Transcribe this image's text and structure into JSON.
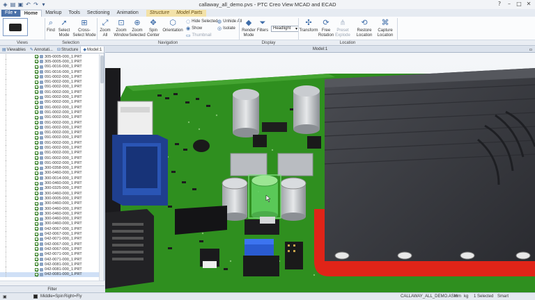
{
  "window": {
    "title": "callaway_all_demo.pvs - PTC Creo View MCAD and ECAD",
    "quick_access_icons": [
      "app-icon",
      "open-icon",
      "save-icon",
      "undo-icon",
      "redo-icon",
      "dropdown-icon"
    ]
  },
  "tabs": [
    {
      "label": "File",
      "kind": "file"
    },
    {
      "label": "Home",
      "kind": "active"
    },
    {
      "label": "Markup",
      "kind": "normal"
    },
    {
      "label": "Tools",
      "kind": "normal"
    },
    {
      "label": "Sectioning",
      "kind": "normal"
    },
    {
      "label": "Animation",
      "kind": "normal"
    },
    {
      "label": "Structure",
      "kind": "ctx"
    },
    {
      "label": "Model Parts",
      "kind": "ctx"
    }
  ],
  "ribbon": {
    "find": "Find",
    "select_mode": "Select Mode",
    "cross_select_mode": "Cross-Select Mode",
    "zoom_all": "Zoom All",
    "zoom_window": "Zoom Window",
    "zoom_selected": "Zoom Selected",
    "spin_center": "Spin Center",
    "orientation": "Orientation",
    "hide_selected": "Hide Selected",
    "show": "Show",
    "thumbnail": "Thumbnail",
    "unhide_all": "Unhide All",
    "isolate": "Isolate",
    "render_mode": "Render Mode",
    "filters": "Filters",
    "lighting": "Headlight",
    "transform": "Transform",
    "free_rotation": "Free Rotation",
    "preset_explode": "Preset Explode",
    "restore_location": "Restore Location",
    "capture_location": "Capture Location",
    "groups": [
      "Views",
      "Selection",
      "Navigation",
      "Display",
      "Location"
    ]
  },
  "panel": {
    "tabs": [
      "Viewables",
      "Annotati...",
      "Structure",
      "Model:1"
    ],
    "filter_label": "Filter",
    "tree_items": [
      "305-0005-000_1.PRT",
      "305-0005-000_1.PRT",
      "091-0016-000_1.PRT",
      "091-0016-000_1.PRT",
      "091-0002-000_1.PRT",
      "091-0002-000_1.PRT",
      "091-0002-000_1.PRT",
      "091-0002-000_1.PRT",
      "091-0002-000_1.PRT",
      "091-0002-000_1.PRT",
      "091-0002-000_1.PRT",
      "091-0002-000_1.PRT",
      "091-0002-000_1.PRT",
      "091-0002-000_1.PRT",
      "091-0002-000_1.PRT",
      "091-0002-000_1.PRT",
      "091-0002-000_1.PRT",
      "091-0002-000_1.PRT",
      "091-0002-000_1.PRT",
      "091-0002-000_1.PRT",
      "091-0002-000_1.PRT",
      "091-0002-000_1.PRT",
      "300-0358-000_1.PRT",
      "300-0460-000_1.PRT",
      "300-0014-000_1.PRT",
      "300-0460-000_1.PRT",
      "300-0325-000_1.PRT",
      "300-0460-000_1.PRT",
      "300-0005-000_1.PRT",
      "300-0460-000_1.PRT",
      "300-0460-000_1.PRT",
      "300-0460-000_1.PRT",
      "300-0460-000_1.PRT",
      "300-0460-000_1.PRT",
      "042-0067-000_1.PRT",
      "042-0067-000_1.PRT",
      "042-0071-000_1.PRT",
      "042-0067-000_1.PRT",
      "042-0067-000_1.PRT",
      "042-0071-000_1.PRT",
      "042-0071-000_1.PRT",
      "042-0081-000_1.PRT",
      "042-0081-000_1.PRT",
      "042-0081-000_1.PRT"
    ],
    "selected_item": "042-0081-000_1.PRT"
  },
  "viewport": {
    "title": "Model:1"
  },
  "status": {
    "middle": "Middle=Spin",
    "right": "Right=Fly",
    "assembly": "CALLAWAY_ALL_DEMO.ASM",
    "units_length": "mm",
    "units_mass": "kg",
    "selected": "1 Selected",
    "mode": "Smart"
  },
  "colors": {
    "pcb": "#2f8f1f",
    "heatsink": "#3b3d43",
    "highlight": "#7fe07f",
    "fan_rim": "#e02418"
  }
}
